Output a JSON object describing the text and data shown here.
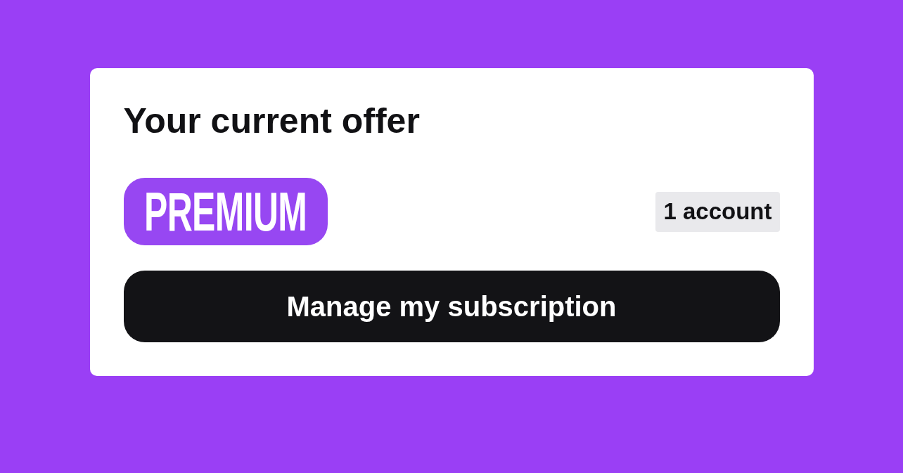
{
  "offer": {
    "title": "Your current offer",
    "plan": {
      "label": "PREMIUM"
    },
    "accounts": "1 account",
    "button": "Manage my subscription"
  }
}
